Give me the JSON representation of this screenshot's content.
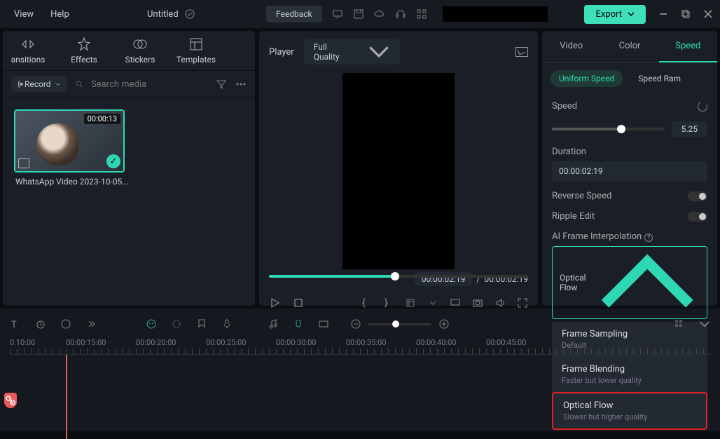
{
  "menu": {
    "view": "View",
    "help": "Help"
  },
  "project": {
    "title": "Untitled"
  },
  "topbar": {
    "feedback": "Feedback",
    "export": "Export"
  },
  "tabs": {
    "transitions": "ansitions",
    "effects": "Effects",
    "stickers": "Stickers",
    "templates": "Templates"
  },
  "media_tools": {
    "record": "Record",
    "search_placeholder": "Search media"
  },
  "clip": {
    "duration": "00:00:13",
    "name": "WhatsApp Video 2023-10-05..."
  },
  "player": {
    "label": "Player",
    "quality": "Full Quality",
    "current_time": "00:00:02:19",
    "total_time": "00:00:02:19",
    "separator": "/"
  },
  "props_tabs": {
    "video": "Video",
    "color": "Color",
    "speed": "Speed"
  },
  "speed_tabs": {
    "uniform": "Uniform Speed",
    "ramp": "Speed Ram"
  },
  "speed_panel": {
    "speed_label": "Speed",
    "speed_value": "5.25",
    "duration_label": "Duration",
    "duration_value": "00:00:02:19",
    "reverse_label": "Reverse Speed",
    "ripple_label": "Ripple Edit",
    "interp_label": "AI Frame Interpolation",
    "interp_value": "Optical Flow",
    "options": {
      "frame_sampling": "Frame Sampling",
      "frame_sampling_sub": "Default",
      "frame_blending": "Frame Blending",
      "frame_blending_sub": "Faster but lower quality",
      "optical_flow": "Optical Flow",
      "optical_flow_sub": "Slower but higher quality"
    }
  },
  "timeline": {
    "marks": [
      "0:10:00",
      "00:00:15:00",
      "00:00:20:00",
      "00:00:25:00",
      "00:00:30:00",
      "00:00:35:00",
      "00:00:40:00",
      "00:00:45:00"
    ]
  }
}
